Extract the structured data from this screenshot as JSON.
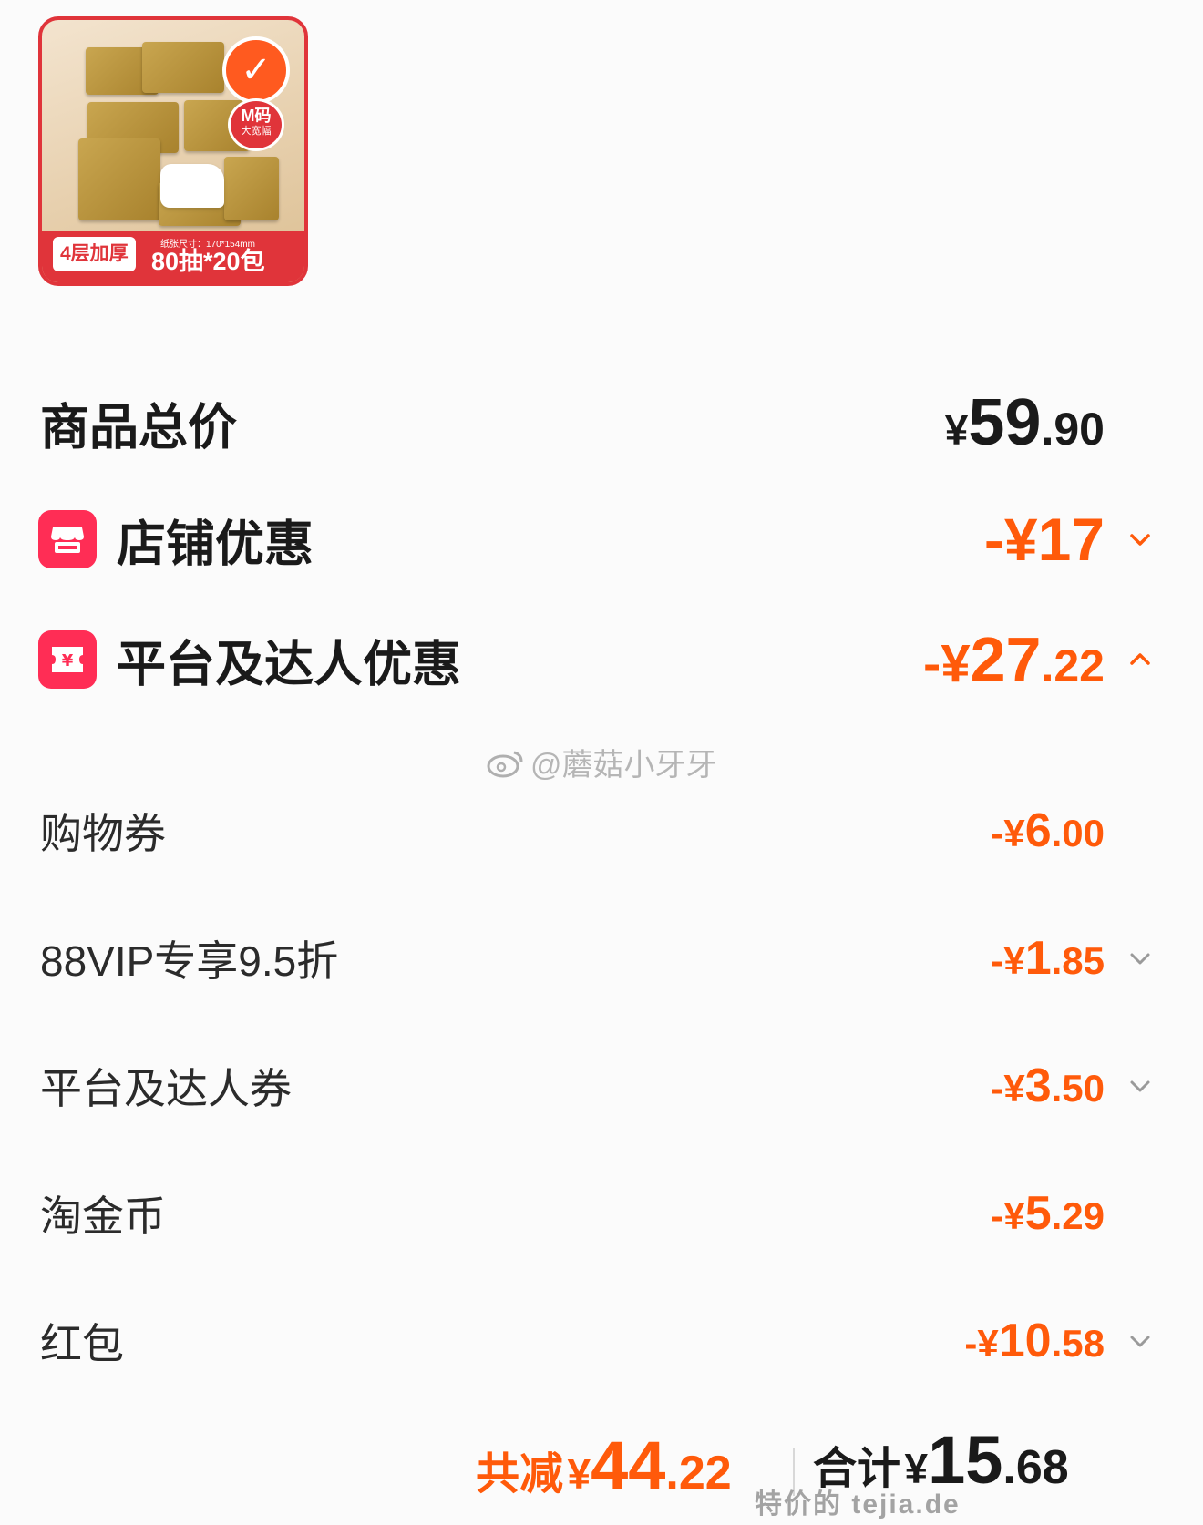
{
  "product": {
    "badge_size": "M码",
    "badge_size_sub": "大宽幅",
    "tag_layers": "4层加厚",
    "spec_text": "纸张尺寸：170*154mm",
    "count_text": "80抽*20包"
  },
  "summary": {
    "total_label": "商品总价",
    "total_currency": "¥",
    "total_int": "59",
    "total_dec": ".90",
    "store_label": "店铺优惠",
    "store_value": "-¥17",
    "platform_label": "平台及达人优惠",
    "platform_sign": "-¥",
    "platform_int": "27",
    "platform_dec": ".22"
  },
  "details": [
    {
      "label": "购物券",
      "sign": "-¥",
      "int": "6",
      "dec": ".00"
    },
    {
      "label": "88VIP专享9.5折",
      "sign": "-¥",
      "int": "1",
      "dec": ".85"
    },
    {
      "label": "平台及达人券",
      "sign": "-¥",
      "int": "3",
      "dec": ".50"
    },
    {
      "label": "淘金币",
      "sign": "-¥",
      "int": "5",
      "dec": ".29"
    },
    {
      "label": "红包",
      "sign": "-¥",
      "int": "10",
      "dec": ".58"
    }
  ],
  "watermark": "@蘑菇小牙牙",
  "footer": {
    "reduce_label": "共减",
    "reduce_currency": "¥",
    "reduce_int": "44",
    "reduce_dec": ".22",
    "total_label": "合计",
    "total_currency": "¥",
    "total_int": "15",
    "total_dec": ".68"
  },
  "site_stamp": "特价的  tejia.de",
  "colors": {
    "accent": "#ff5a0a",
    "badge": "#ff2d55",
    "product_red": "#e0343a"
  }
}
